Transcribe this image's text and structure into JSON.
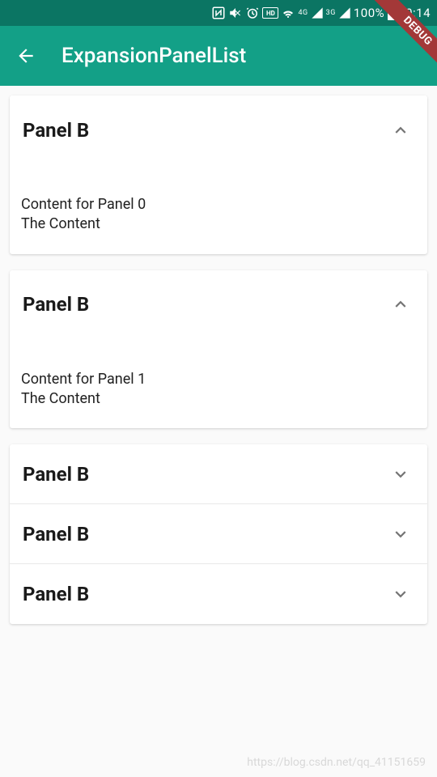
{
  "status_bar": {
    "battery_pct": "100%",
    "time": "00:14",
    "hd_label": "HD",
    "net1": "4G",
    "net2": "3G"
  },
  "app_bar": {
    "title": "ExpansionPanelList"
  },
  "debug_banner": "DEBUG",
  "panels": [
    {
      "title": "Panel B",
      "expanded": true,
      "content_line1": "Content for Panel 0",
      "content_line2": " The Content"
    },
    {
      "title": "Panel B",
      "expanded": true,
      "content_line1": "Content for Panel 1",
      "content_line2": " The Content"
    },
    {
      "title": "Panel B",
      "expanded": false
    },
    {
      "title": "Panel B",
      "expanded": false
    },
    {
      "title": "Panel B",
      "expanded": false
    }
  ],
  "watermark": "https://blog.csdn.net/qq_41151659",
  "colors": {
    "status_bar_bg": "#0B7563",
    "app_bar_bg": "#13A087",
    "page_bg": "#FAFAFA",
    "panel_bg": "#FFFFFF"
  }
}
